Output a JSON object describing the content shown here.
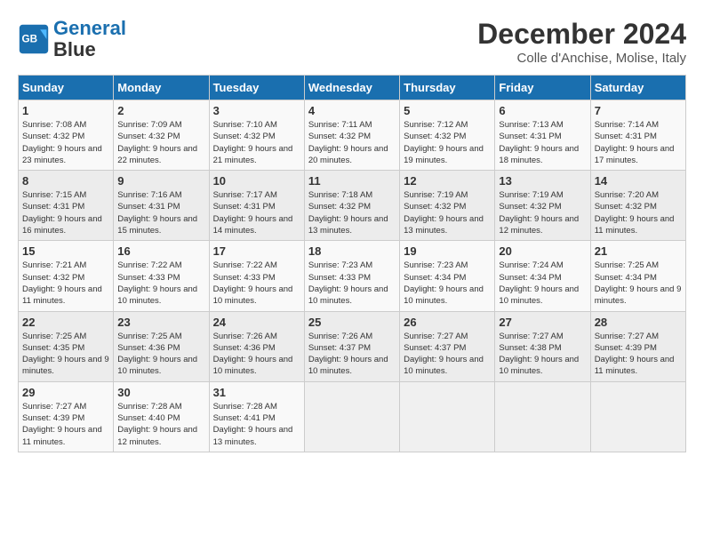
{
  "header": {
    "logo_line1": "General",
    "logo_line2": "Blue",
    "month": "December 2024",
    "location": "Colle d'Anchise, Molise, Italy"
  },
  "weekdays": [
    "Sunday",
    "Monday",
    "Tuesday",
    "Wednesday",
    "Thursday",
    "Friday",
    "Saturday"
  ],
  "weeks": [
    [
      {
        "day": "1",
        "sunrise": "Sunrise: 7:08 AM",
        "sunset": "Sunset: 4:32 PM",
        "daylight": "Daylight: 9 hours and 23 minutes."
      },
      {
        "day": "2",
        "sunrise": "Sunrise: 7:09 AM",
        "sunset": "Sunset: 4:32 PM",
        "daylight": "Daylight: 9 hours and 22 minutes."
      },
      {
        "day": "3",
        "sunrise": "Sunrise: 7:10 AM",
        "sunset": "Sunset: 4:32 PM",
        "daylight": "Daylight: 9 hours and 21 minutes."
      },
      {
        "day": "4",
        "sunrise": "Sunrise: 7:11 AM",
        "sunset": "Sunset: 4:32 PM",
        "daylight": "Daylight: 9 hours and 20 minutes."
      },
      {
        "day": "5",
        "sunrise": "Sunrise: 7:12 AM",
        "sunset": "Sunset: 4:32 PM",
        "daylight": "Daylight: 9 hours and 19 minutes."
      },
      {
        "day": "6",
        "sunrise": "Sunrise: 7:13 AM",
        "sunset": "Sunset: 4:31 PM",
        "daylight": "Daylight: 9 hours and 18 minutes."
      },
      {
        "day": "7",
        "sunrise": "Sunrise: 7:14 AM",
        "sunset": "Sunset: 4:31 PM",
        "daylight": "Daylight: 9 hours and 17 minutes."
      }
    ],
    [
      {
        "day": "8",
        "sunrise": "Sunrise: 7:15 AM",
        "sunset": "Sunset: 4:31 PM",
        "daylight": "Daylight: 9 hours and 16 minutes."
      },
      {
        "day": "9",
        "sunrise": "Sunrise: 7:16 AM",
        "sunset": "Sunset: 4:31 PM",
        "daylight": "Daylight: 9 hours and 15 minutes."
      },
      {
        "day": "10",
        "sunrise": "Sunrise: 7:17 AM",
        "sunset": "Sunset: 4:31 PM",
        "daylight": "Daylight: 9 hours and 14 minutes."
      },
      {
        "day": "11",
        "sunrise": "Sunrise: 7:18 AM",
        "sunset": "Sunset: 4:32 PM",
        "daylight": "Daylight: 9 hours and 13 minutes."
      },
      {
        "day": "12",
        "sunrise": "Sunrise: 7:19 AM",
        "sunset": "Sunset: 4:32 PM",
        "daylight": "Daylight: 9 hours and 13 minutes."
      },
      {
        "day": "13",
        "sunrise": "Sunrise: 7:19 AM",
        "sunset": "Sunset: 4:32 PM",
        "daylight": "Daylight: 9 hours and 12 minutes."
      },
      {
        "day": "14",
        "sunrise": "Sunrise: 7:20 AM",
        "sunset": "Sunset: 4:32 PM",
        "daylight": "Daylight: 9 hours and 11 minutes."
      }
    ],
    [
      {
        "day": "15",
        "sunrise": "Sunrise: 7:21 AM",
        "sunset": "Sunset: 4:32 PM",
        "daylight": "Daylight: 9 hours and 11 minutes."
      },
      {
        "day": "16",
        "sunrise": "Sunrise: 7:22 AM",
        "sunset": "Sunset: 4:33 PM",
        "daylight": "Daylight: 9 hours and 10 minutes."
      },
      {
        "day": "17",
        "sunrise": "Sunrise: 7:22 AM",
        "sunset": "Sunset: 4:33 PM",
        "daylight": "Daylight: 9 hours and 10 minutes."
      },
      {
        "day": "18",
        "sunrise": "Sunrise: 7:23 AM",
        "sunset": "Sunset: 4:33 PM",
        "daylight": "Daylight: 9 hours and 10 minutes."
      },
      {
        "day": "19",
        "sunrise": "Sunrise: 7:23 AM",
        "sunset": "Sunset: 4:34 PM",
        "daylight": "Daylight: 9 hours and 10 minutes."
      },
      {
        "day": "20",
        "sunrise": "Sunrise: 7:24 AM",
        "sunset": "Sunset: 4:34 PM",
        "daylight": "Daylight: 9 hours and 10 minutes."
      },
      {
        "day": "21",
        "sunrise": "Sunrise: 7:25 AM",
        "sunset": "Sunset: 4:34 PM",
        "daylight": "Daylight: 9 hours and 9 minutes."
      }
    ],
    [
      {
        "day": "22",
        "sunrise": "Sunrise: 7:25 AM",
        "sunset": "Sunset: 4:35 PM",
        "daylight": "Daylight: 9 hours and 9 minutes."
      },
      {
        "day": "23",
        "sunrise": "Sunrise: 7:25 AM",
        "sunset": "Sunset: 4:36 PM",
        "daylight": "Daylight: 9 hours and 10 minutes."
      },
      {
        "day": "24",
        "sunrise": "Sunrise: 7:26 AM",
        "sunset": "Sunset: 4:36 PM",
        "daylight": "Daylight: 9 hours and 10 minutes."
      },
      {
        "day": "25",
        "sunrise": "Sunrise: 7:26 AM",
        "sunset": "Sunset: 4:37 PM",
        "daylight": "Daylight: 9 hours and 10 minutes."
      },
      {
        "day": "26",
        "sunrise": "Sunrise: 7:27 AM",
        "sunset": "Sunset: 4:37 PM",
        "daylight": "Daylight: 9 hours and 10 minutes."
      },
      {
        "day": "27",
        "sunrise": "Sunrise: 7:27 AM",
        "sunset": "Sunset: 4:38 PM",
        "daylight": "Daylight: 9 hours and 10 minutes."
      },
      {
        "day": "28",
        "sunrise": "Sunrise: 7:27 AM",
        "sunset": "Sunset: 4:39 PM",
        "daylight": "Daylight: 9 hours and 11 minutes."
      }
    ],
    [
      {
        "day": "29",
        "sunrise": "Sunrise: 7:27 AM",
        "sunset": "Sunset: 4:39 PM",
        "daylight": "Daylight: 9 hours and 11 minutes."
      },
      {
        "day": "30",
        "sunrise": "Sunrise: 7:28 AM",
        "sunset": "Sunset: 4:40 PM",
        "daylight": "Daylight: 9 hours and 12 minutes."
      },
      {
        "day": "31",
        "sunrise": "Sunrise: 7:28 AM",
        "sunset": "Sunset: 4:41 PM",
        "daylight": "Daylight: 9 hours and 13 minutes."
      },
      null,
      null,
      null,
      null
    ]
  ]
}
